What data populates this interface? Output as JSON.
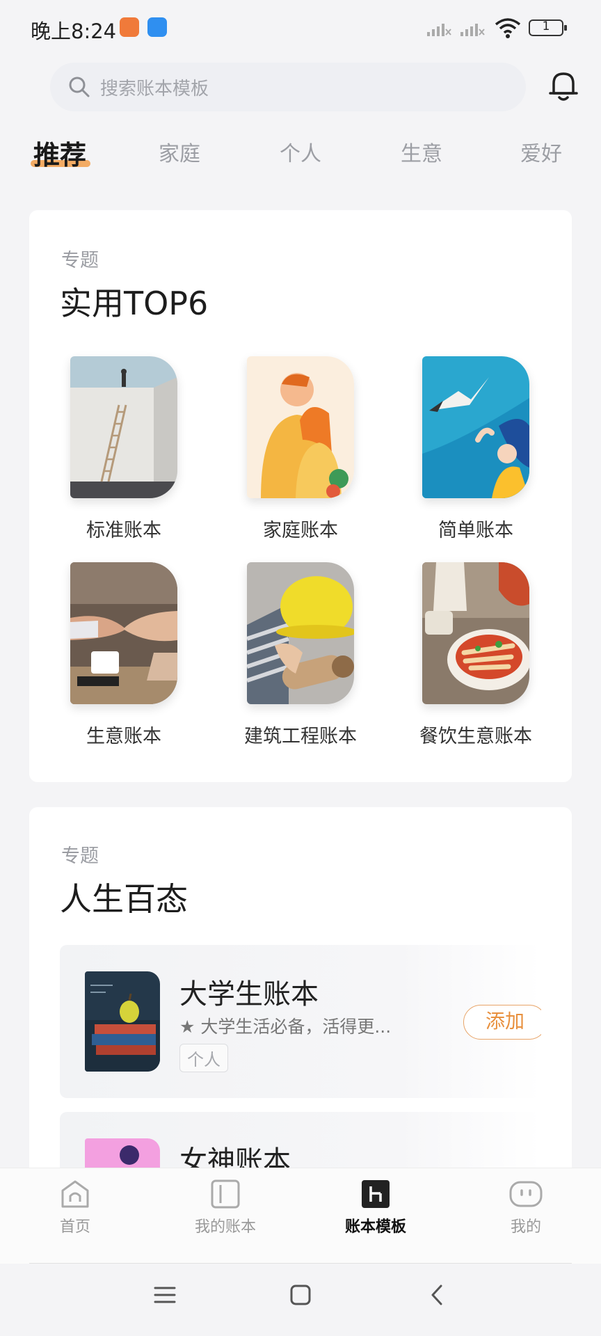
{
  "status_bar": {
    "time": "晚上8:24",
    "battery": "1"
  },
  "search": {
    "placeholder": "搜索账本模板"
  },
  "tabs": [
    {
      "label": "推荐",
      "active": true
    },
    {
      "label": "家庭"
    },
    {
      "label": "个人"
    },
    {
      "label": "生意"
    },
    {
      "label": "爱好"
    }
  ],
  "section_top6": {
    "kicker": "专题",
    "title": "实用TOP6",
    "items": [
      {
        "label": "标准账本"
      },
      {
        "label": "家庭账本"
      },
      {
        "label": "简单账本"
      },
      {
        "label": "生意账本"
      },
      {
        "label": "建筑工程账本"
      },
      {
        "label": "餐饮生意账本"
      }
    ]
  },
  "section_life": {
    "kicker": "专题",
    "title": "人生百态",
    "templates": [
      {
        "name": "大学生账本",
        "desc": "★ 大学生活必备，活得更...",
        "tag": "个人",
        "action": "添加"
      },
      {
        "name": "女神账本"
      }
    ]
  },
  "bottom_nav": [
    {
      "label": "首页"
    },
    {
      "label": "我的账本"
    },
    {
      "label": "账本模板",
      "active": true
    },
    {
      "label": "我的"
    }
  ],
  "colors": {
    "accent": "#e8903e",
    "tab_underline": "#f29d4a",
    "active_text": "#111111"
  }
}
